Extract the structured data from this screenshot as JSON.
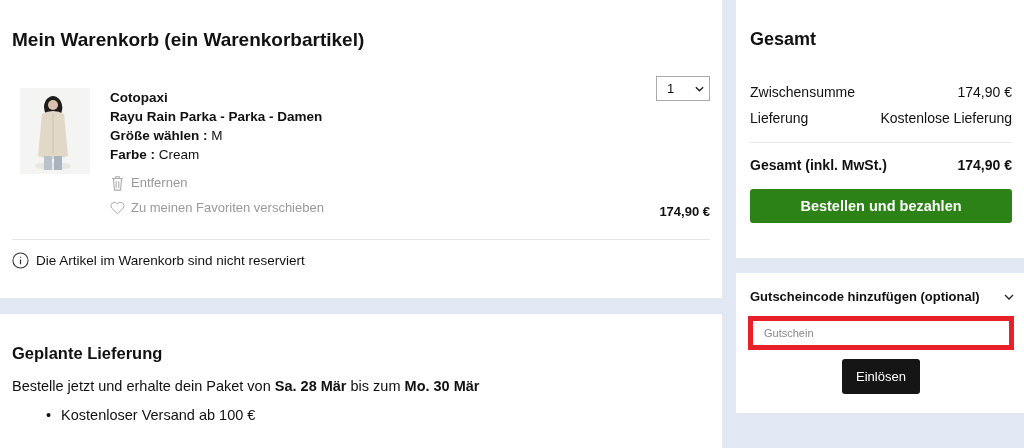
{
  "cart": {
    "title": "Mein Warenkorb (ein Warenkorbartikel)",
    "item": {
      "kind": "picture",
      "brand": "Cotopaxi",
      "name": "Rayu Rain Parka - Parka - Damen",
      "attributes": [
        {
          "label": "Größe wählen :",
          "value": "M"
        },
        {
          "label": "Farbe :",
          "value": "Cream"
        }
      ],
      "actions": [
        {
          "kind": "remove",
          "label": "Entfernen"
        },
        {
          "kind": "favorite",
          "label": "Zu meinen Favoriten verschieben"
        }
      ],
      "quantity": "1",
      "price": "174,90 €"
    },
    "notice": "Die Artikel im Warenkorb sind nicht reserviert"
  },
  "delivery": {
    "title": "Geplante Lieferung",
    "text": "Bestelle jetzt und erhalte dein Paket von **Sa. 28 Mär** bis zum **Mo. 30 Mär**",
    "bullets": [
      {
        "marker": "•",
        "text": "Kostenloser Versand ab 100 €"
      }
    ]
  },
  "summary": {
    "title": "Gesamt",
    "rows": [
      {
        "label": "Zwischensumme",
        "value": "174,90 €"
      },
      {
        "label": "Lieferung",
        "value": "Kostenlose Lieferung"
      }
    ],
    "total": {
      "label": "Gesamt (inkl. MwSt.)",
      "value": "174,90 €"
    },
    "checkout_button": "Bestellen und bezahlen"
  },
  "voucher": {
    "title": "Gutscheincode hinzufügen (optional)",
    "expanded": true,
    "highlighted": true,
    "placeholder": "Gutschein",
    "button": "Einlösen"
  }
}
